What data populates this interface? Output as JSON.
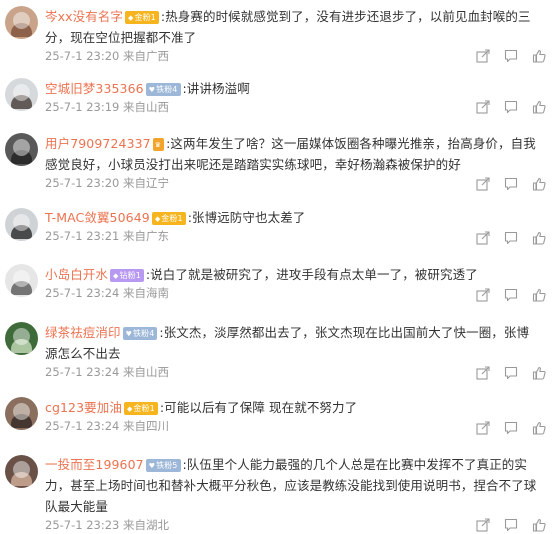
{
  "comments": [
    {
      "username": "岑xx没有名字",
      "badge": "金粉1",
      "badge_style": "gold",
      "text": ":热身赛的时候就感觉到了，没有进步还退步了，以前见血封喉的三分，现在空位把握都不准了",
      "time": "25-7-1 23:20",
      "location": "来自广西",
      "avatar_color": "#c9a48a",
      "avatar_accent": "#7a4b35"
    },
    {
      "username": "空城旧梦335366",
      "badge": "铁粉4",
      "badge_style": "silver",
      "text": ":讲讲杨溢啊",
      "time": "25-7-1 23:19",
      "location": "来自山西",
      "avatar_color": "#d6d9dc",
      "avatar_accent": "#3a2f2a"
    },
    {
      "username": "用户7909724337",
      "badge": "",
      "badge_style": "diamond",
      "text": ":这两年发生了啥？这一届媒体饭圈各种曝光推亲，抬高身价，自我感觉良好，小球员没打出来呢还是踏踏实实练球吧，幸好杨瀚森被保护的好",
      "time": "25-7-1 23:20",
      "location": "来自辽宁",
      "avatar_color": "#595959",
      "avatar_accent": "#1e1e1e"
    },
    {
      "username": "T-MAC敛翼50649",
      "badge": "金粉1",
      "badge_style": "gold",
      "text": ":张博远防守也太差了",
      "time": "25-7-1 23:21",
      "location": "来自广东",
      "avatar_color": "#cfd3d6",
      "avatar_accent": "#1c1c1c"
    },
    {
      "username": "小岛白开水",
      "badge": "钻粉1",
      "badge_style": "purple",
      "text": ":说白了就是被研究了，进攻手段有点太单一了，被研究透了",
      "time": "25-7-1 23:24",
      "location": "来自海南",
      "avatar_color": "#e6e6e6",
      "avatar_accent": "#4d4d4d"
    },
    {
      "username": "绿茶祛痘消印",
      "badge": "铁粉4",
      "badge_style": "silver",
      "text": ":张文杰，淡厚然都出去了，张文杰现在比出国前大了快一圈，张博源怎么不出去",
      "time": "25-7-1 23:24",
      "location": "来自山西",
      "avatar_color": "#3f6b3a",
      "avatar_accent": "#cfe3c2"
    },
    {
      "username": "cg123要加油",
      "badge": "金粉1",
      "badge_style": "gold",
      "text": ":可能以后有了保障 现在就不努力了",
      "time": "25-7-1 23:24",
      "location": "来自四川",
      "avatar_color": "#8a6f5e",
      "avatar_accent": "#2e2420"
    },
    {
      "username": "一投而至199607",
      "badge": "铁粉5",
      "badge_style": "silver",
      "text": ":队伍里个人能力最强的几个人总是在比赛中发挥不了真正的实力，甚至上场时间也和替补大概平分秋色，应该是教练没能找到使用说明书，捏合不了球队最大能量",
      "time": "25-7-1 23:23",
      "location": "来自湖北",
      "avatar_color": "#6a5148",
      "avatar_accent": "#d9b7a0"
    }
  ],
  "icons": {
    "share": "share-icon",
    "comment": "comment-icon",
    "like": "thumbs-up-icon"
  },
  "colors": {
    "username": "#eb7350",
    "meta": "#999999",
    "text": "#333333"
  }
}
